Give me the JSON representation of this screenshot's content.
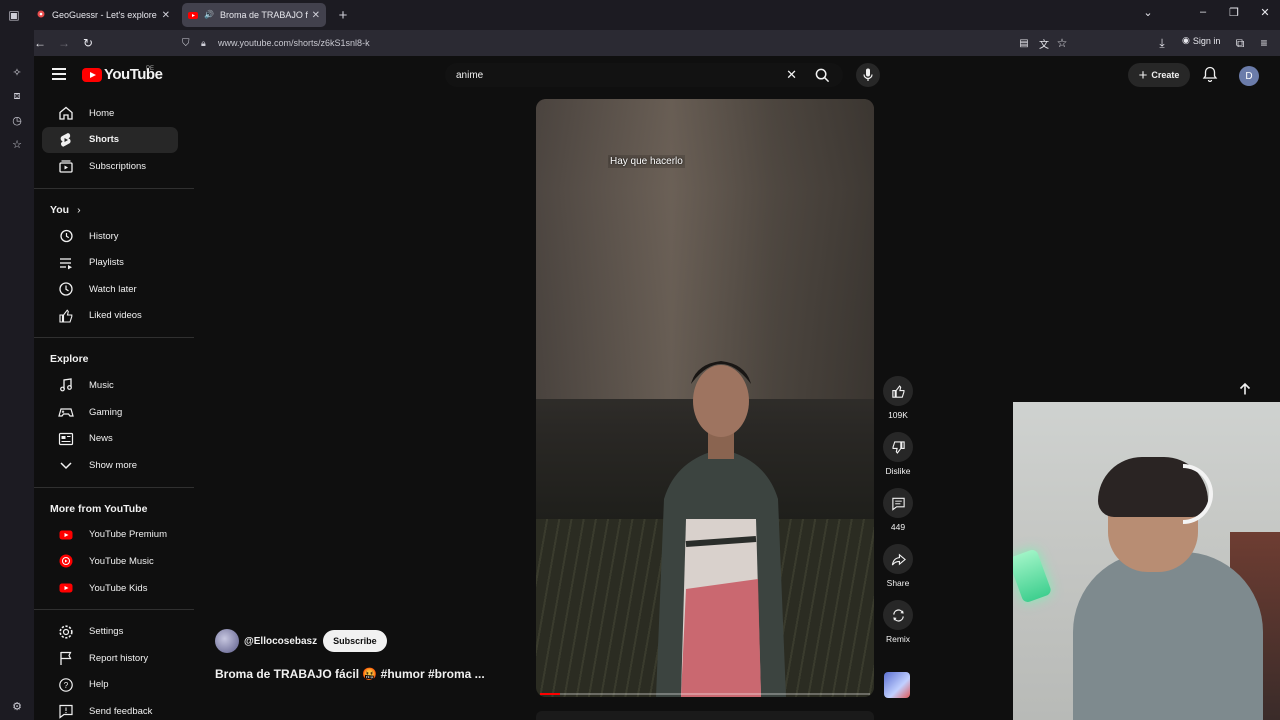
{
  "browser": {
    "tabs": [
      {
        "title": "GeoGuessr - Let's explore the w",
        "active": false
      },
      {
        "title": "Broma de TRABAJO fácil",
        "active": true
      }
    ],
    "url": "www.youtube.com/shorts/z6kS1snl8-k",
    "signin_label": "Sign in"
  },
  "youtube": {
    "logo_text": "YouTube",
    "country_code": "PE",
    "search_query": "anime",
    "create_label": "Create",
    "avatar_letter": "D",
    "guide": {
      "main": [
        {
          "label": "Home",
          "icon": "home-icon"
        },
        {
          "label": "Shorts",
          "icon": "shorts-icon",
          "selected": true
        },
        {
          "label": "Subscriptions",
          "icon": "subscriptions-icon"
        }
      ],
      "you_heading": "You",
      "you": [
        {
          "label": "History",
          "icon": "history-icon"
        },
        {
          "label": "Playlists",
          "icon": "playlists-icon"
        },
        {
          "label": "Watch later",
          "icon": "watch-later-icon"
        },
        {
          "label": "Liked videos",
          "icon": "liked-videos-icon"
        }
      ],
      "explore_heading": "Explore",
      "explore": [
        {
          "label": "Music",
          "icon": "music-icon"
        },
        {
          "label": "Gaming",
          "icon": "gaming-icon"
        },
        {
          "label": "News",
          "icon": "news-icon"
        },
        {
          "label": "Show more",
          "icon": "chevron-down-icon"
        }
      ],
      "more_heading": "More from YouTube",
      "more": [
        {
          "label": "YouTube Premium"
        },
        {
          "label": "YouTube Music"
        },
        {
          "label": "YouTube Kids"
        }
      ],
      "footer": [
        {
          "label": "Settings",
          "icon": "settings-icon"
        },
        {
          "label": "Report history",
          "icon": "flag-icon"
        },
        {
          "label": "Help",
          "icon": "help-icon"
        },
        {
          "label": "Send feedback",
          "icon": "feedback-icon"
        }
      ]
    },
    "short": {
      "caption": "Hay que hacerlo",
      "channel": "@Ellocosebasz",
      "subscribe_label": "Subscribe",
      "title": "Broma de TRABAJO fácil 🤬 #humor #broma ...",
      "progress": 0.06,
      "actions": {
        "likes": "109K",
        "dislike": "Dislike",
        "comments": "449",
        "share": "Share",
        "remix": "Remix"
      }
    }
  },
  "colors": {
    "background": "#0f0f0f",
    "accent_red": "#ff0000",
    "chip": "#272727"
  }
}
